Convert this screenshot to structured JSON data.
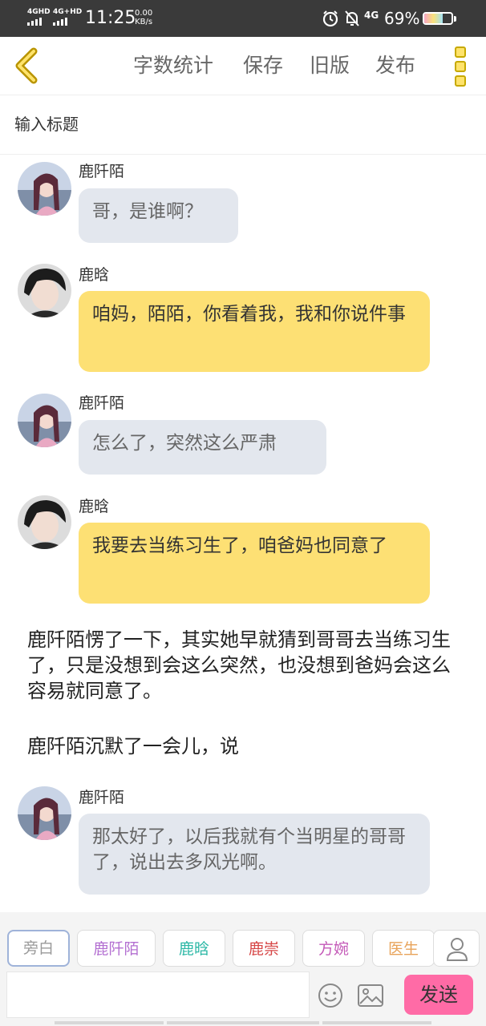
{
  "status_bar": {
    "network_1": "4GHD",
    "network_2": "4G+HD",
    "time": "11:25",
    "speed_value": "0.00",
    "speed_unit": "KB/s",
    "network_right": "4G",
    "battery": "69%",
    "battery_level": 0.69
  },
  "toolbar": {
    "word_count": "字数统计",
    "save": "保存",
    "old_version": "旧版",
    "publish": "发布",
    "back_icon": "chevron-left-icon",
    "menu_icon": "more-vertical-icon"
  },
  "title_placeholder": "输入标题",
  "messages": [
    {
      "name": "鹿阡陌",
      "text": "哥，是谁啊？",
      "style": "grey"
    },
    {
      "name": "鹿晗",
      "text": "咱妈，陌陌，你看着我，我和你说件事",
      "style": "yellow"
    },
    {
      "name": "鹿阡陌",
      "text": "怎么了，突然这么严肃",
      "style": "grey"
    },
    {
      "name": "鹿晗",
      "text": "我要去当练习生了，咱爸妈也同意了",
      "style": "yellow"
    },
    {
      "name": "鹿阡陌",
      "text": "那太好了，以后我就有个当明星的哥哥了，说出去多风光啊。",
      "style": "grey"
    }
  ],
  "narrations": [
    "鹿阡陌愣了一下，其实她早就猜到哥哥去当练习生了，只是没想到会这么突然，也没想到爸妈会这么容易就同意了。",
    "鹿阡陌沉默了一会儿，说"
  ],
  "roles": [
    {
      "label": "旁白",
      "color": "#9a9a9a"
    },
    {
      "label": "鹿阡陌",
      "color": "#b36fd1"
    },
    {
      "label": "鹿晗",
      "color": "#2db8a6"
    },
    {
      "label": "鹿崇",
      "color": "#d64545"
    },
    {
      "label": "方婉",
      "color": "#c459b8"
    },
    {
      "label": "医生",
      "color": "#e8a35a"
    }
  ],
  "compose": {
    "send": "发送",
    "emoji_icon": "smiley-icon",
    "image_icon": "image-icon",
    "person_icon": "user-icon"
  }
}
